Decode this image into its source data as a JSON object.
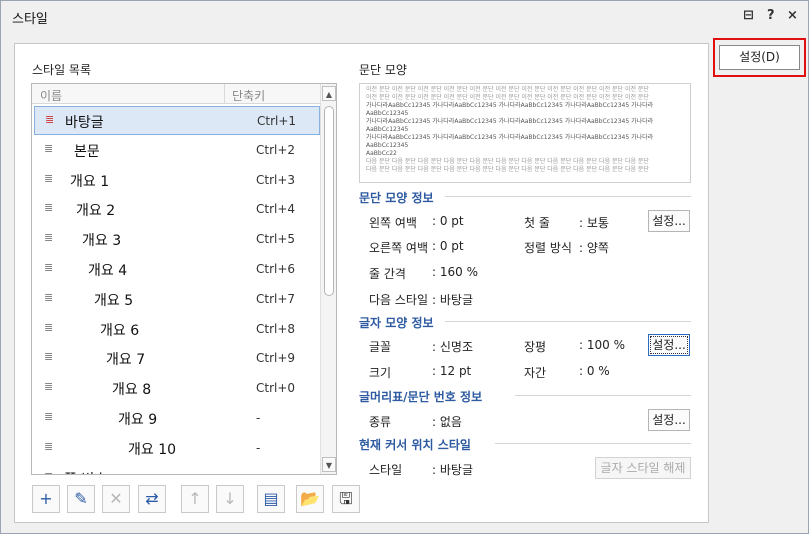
{
  "window": {
    "title": "스타일",
    "btn_restore": "⊟",
    "btn_help": "?",
    "btn_close": "×"
  },
  "main_button": {
    "label": "설정(D)"
  },
  "list": {
    "label": "스타일 목록",
    "col_name": "이름",
    "col_shortcut": "단축키",
    "items": [
      {
        "name": "바탕글",
        "shortcut": "Ctrl+1"
      },
      {
        "name": "본문",
        "shortcut": "Ctrl+2"
      },
      {
        "name": "개요 1",
        "shortcut": "Ctrl+3"
      },
      {
        "name": "개요 2",
        "shortcut": "Ctrl+4"
      },
      {
        "name": "개요 3",
        "shortcut": "Ctrl+5"
      },
      {
        "name": "개요 4",
        "shortcut": "Ctrl+6"
      },
      {
        "name": "개요 5",
        "shortcut": "Ctrl+7"
      },
      {
        "name": "개요 6",
        "shortcut": "Ctrl+8"
      },
      {
        "name": "개요 7",
        "shortcut": "Ctrl+9"
      },
      {
        "name": "개요 8",
        "shortcut": "Ctrl+0"
      },
      {
        "name": "개요 9",
        "shortcut": "-"
      },
      {
        "name": "개요 10",
        "shortcut": "-"
      },
      {
        "name": "쪽 번호",
        "shortcut": ""
      }
    ]
  },
  "preview": {
    "label": "문단 모양",
    "gray_line": "이전 문단 이전 문단 이전 문단 이전 문단 이전 문단 이전 문단 이전 문단 이전 문단 이전 문단 이전 문단 이전 문단",
    "sample_line": "가나다라AaBbCc12345 가나다라AaBbCc12345 가나다라AaBbCc12345 가나다라AaBbCc12345 가나다라AaBbCc12345",
    "sample_last": "AaBbCc22",
    "next_line": "다음 문단 다음 문단 다음 문단 다음 문단 다음 문단 다음 문단 다음 문단 다음 문단 다음 문단 다음 문단 다음 문단"
  },
  "para_info": {
    "title": "문단 모양 정보",
    "left_margin_label": "왼쪽 여백",
    "left_margin": ": 0 pt",
    "first_line_label": "첫 줄",
    "first_line": ": 보통",
    "right_margin_label": "오른쪽 여백",
    "right_margin": ": 0 pt",
    "align_label": "정렬 방식",
    "align": ": 양쪽",
    "line_spacing_label": "줄 간격",
    "line_spacing": ": 160 %",
    "next_style_label": "다음 스타일",
    "next_style": ": 바탕글",
    "setup_button": "설정..."
  },
  "char_info": {
    "title": "글자 모양 정보",
    "font_label": "글꼴",
    "font": ": 신명조",
    "width_label": "장평",
    "width": ": 100 %",
    "size_label": "크기",
    "size": ": 12 pt",
    "spacing_label": "자간",
    "spacing": ": 0 %",
    "setup_button": "설정..."
  },
  "bullet_info": {
    "title": "글머리표/문단 번호 정보",
    "type_label": "종류",
    "type": ": 없음",
    "setup_button": "설정..."
  },
  "cursor_style": {
    "title": "현재 커서 위치 스타일",
    "style_label": "스타일",
    "style": ": 바탕글",
    "release_button": "글자 스타일 해제"
  },
  "toolbar": {
    "add": "+",
    "edit": "✎",
    "delete": "✕",
    "replace": "⇄",
    "up": "↑",
    "down": "↓",
    "import": "▤",
    "open": "📂",
    "save": "🖫"
  }
}
